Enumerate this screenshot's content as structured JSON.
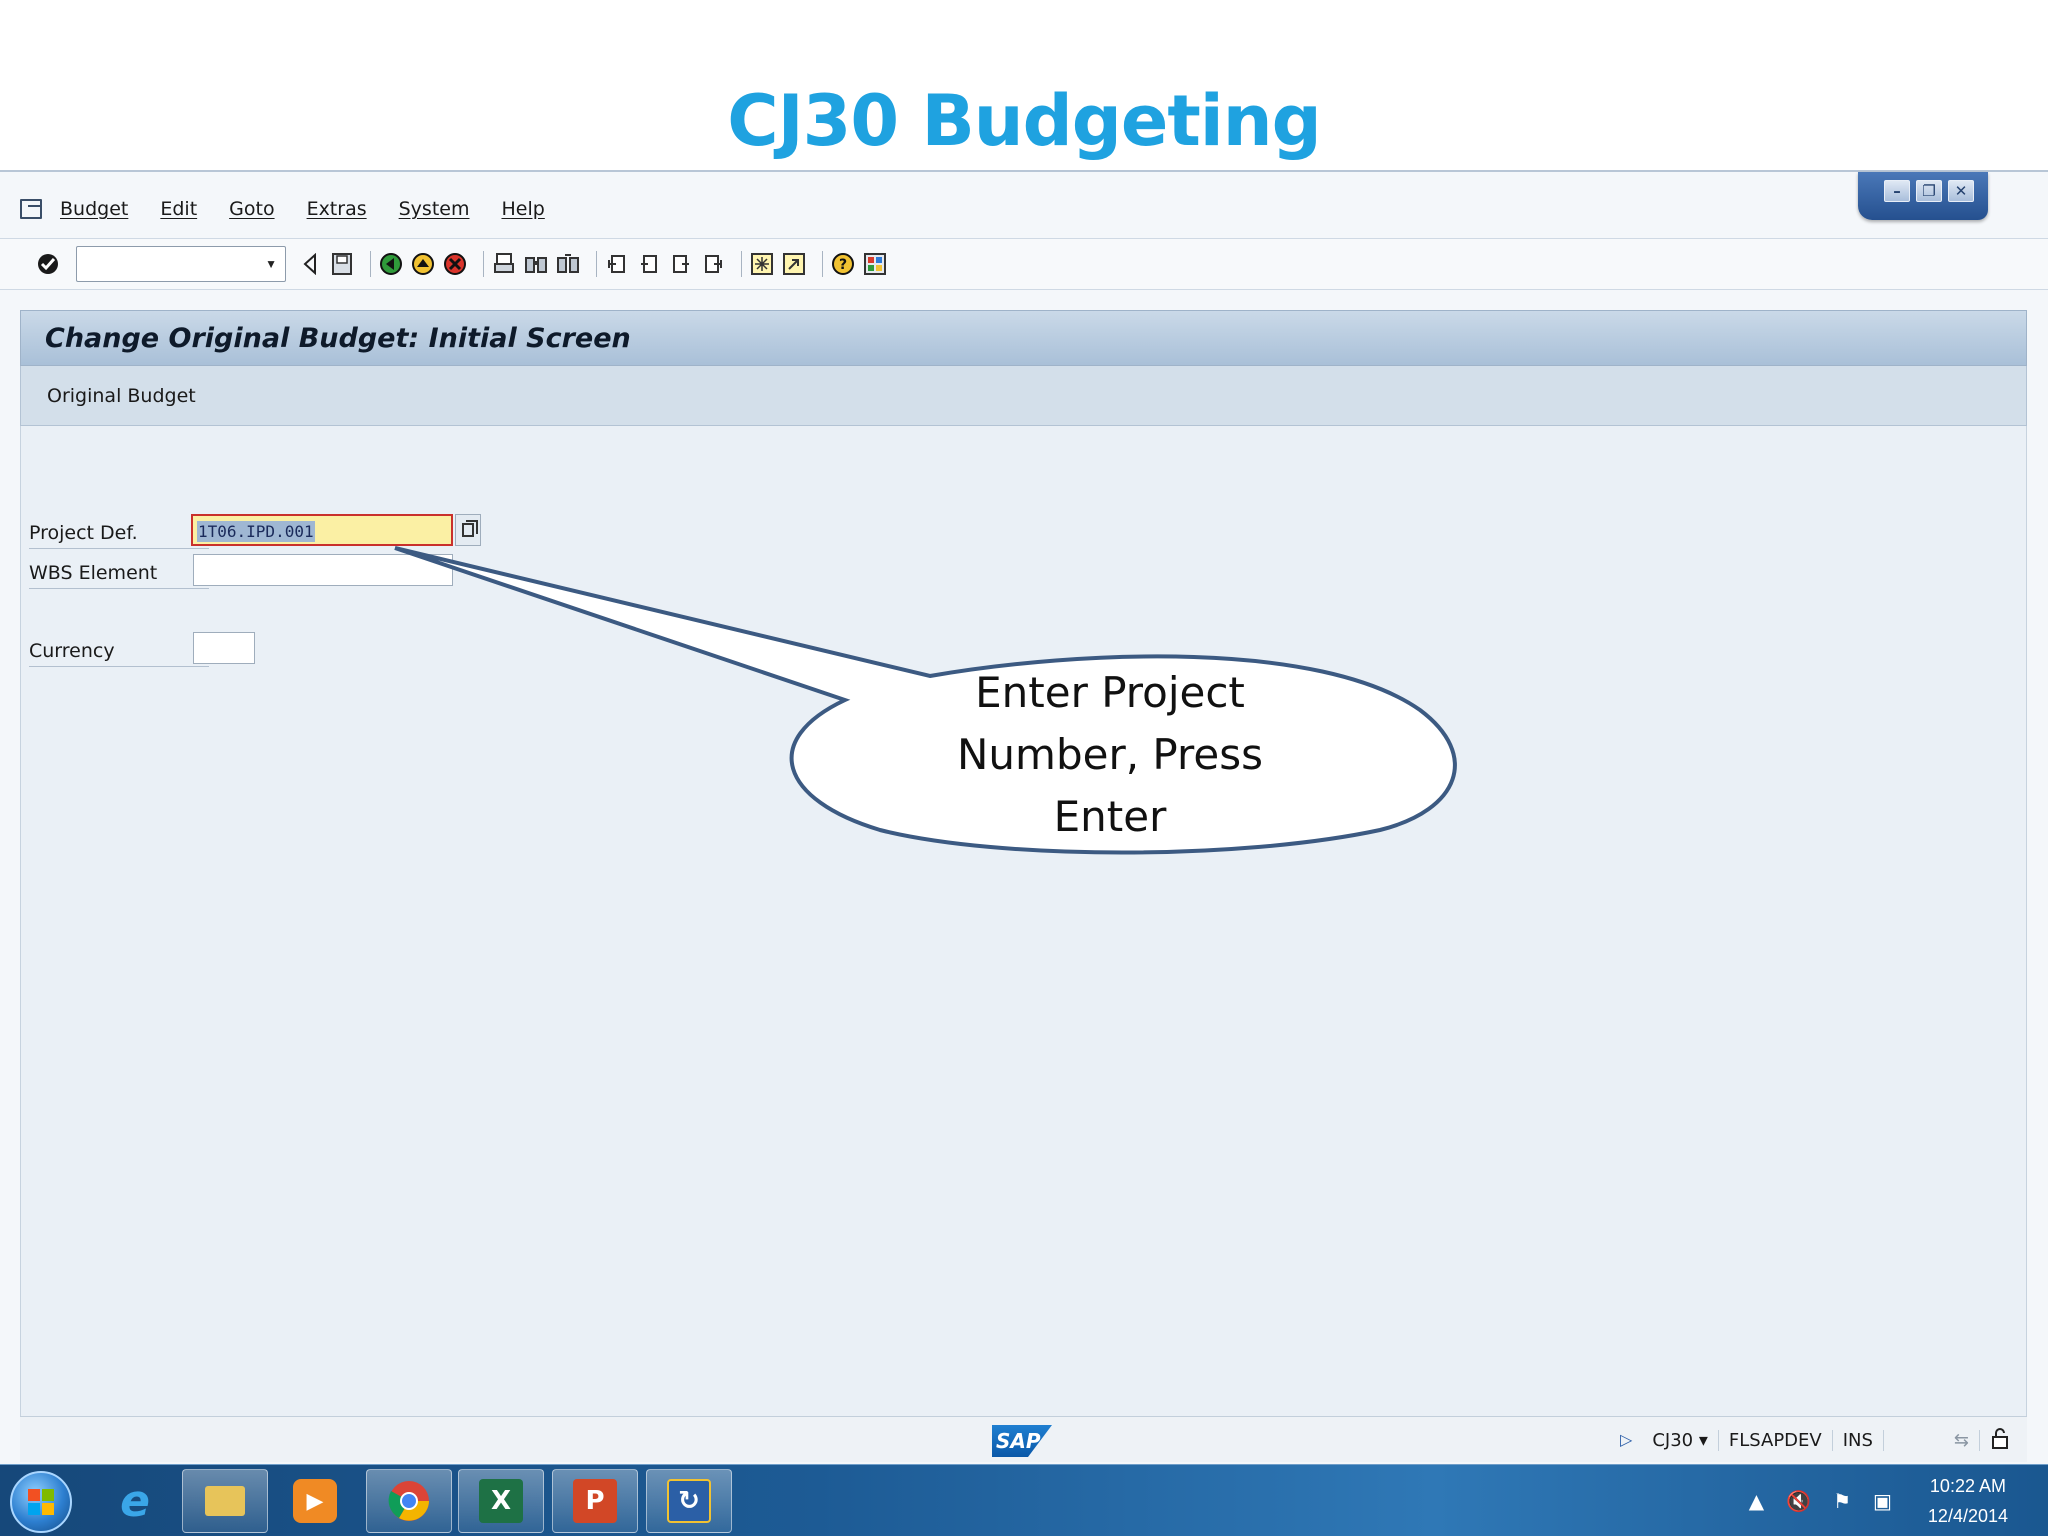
{
  "slide": {
    "title": "CJ30 Budgeting"
  },
  "window_controls": {
    "minimize": "–",
    "restore": "❐",
    "close": "✕"
  },
  "menu": {
    "items": [
      "Budget",
      "Edit",
      "Goto",
      "Extras",
      "System",
      "Help"
    ]
  },
  "toolbar": {
    "command_field_value": "",
    "icons": [
      "enter-icon",
      "back-icon",
      "save-icon",
      "back-green-icon",
      "exit-icon",
      "cancel-icon",
      "print-icon",
      "find-icon",
      "find-next-icon",
      "first-page-icon",
      "previous-page-icon",
      "next-page-icon",
      "last-page-icon",
      "create-session-icon",
      "shortcut-icon",
      "help-icon",
      "customize-layout-icon"
    ]
  },
  "screen": {
    "title": "Change Original Budget: Initial Screen",
    "app_toolbar_label": "Original Budget"
  },
  "form": {
    "project_def_label": "Project Def.",
    "project_def_value": "1T06.IPD.001",
    "wbs_label": "WBS Element",
    "wbs_value": "",
    "currency_label": "Currency",
    "currency_value": ""
  },
  "callout": {
    "line1": "Enter Project",
    "line2": "Number, Press",
    "line3": "Enter",
    "fill": "#ffffff",
    "stroke": "#3c5a82"
  },
  "statusbar": {
    "sap_logo": "SAP",
    "transaction": "CJ30",
    "system": "FLSAPDEV",
    "mode": "INS"
  },
  "taskbar": {
    "apps": [
      "internet-explorer",
      "file-explorer",
      "media-player",
      "chrome",
      "excel",
      "powerpoint",
      "sap-logon"
    ],
    "time": "10:22 AM",
    "date": "12/4/2014"
  }
}
